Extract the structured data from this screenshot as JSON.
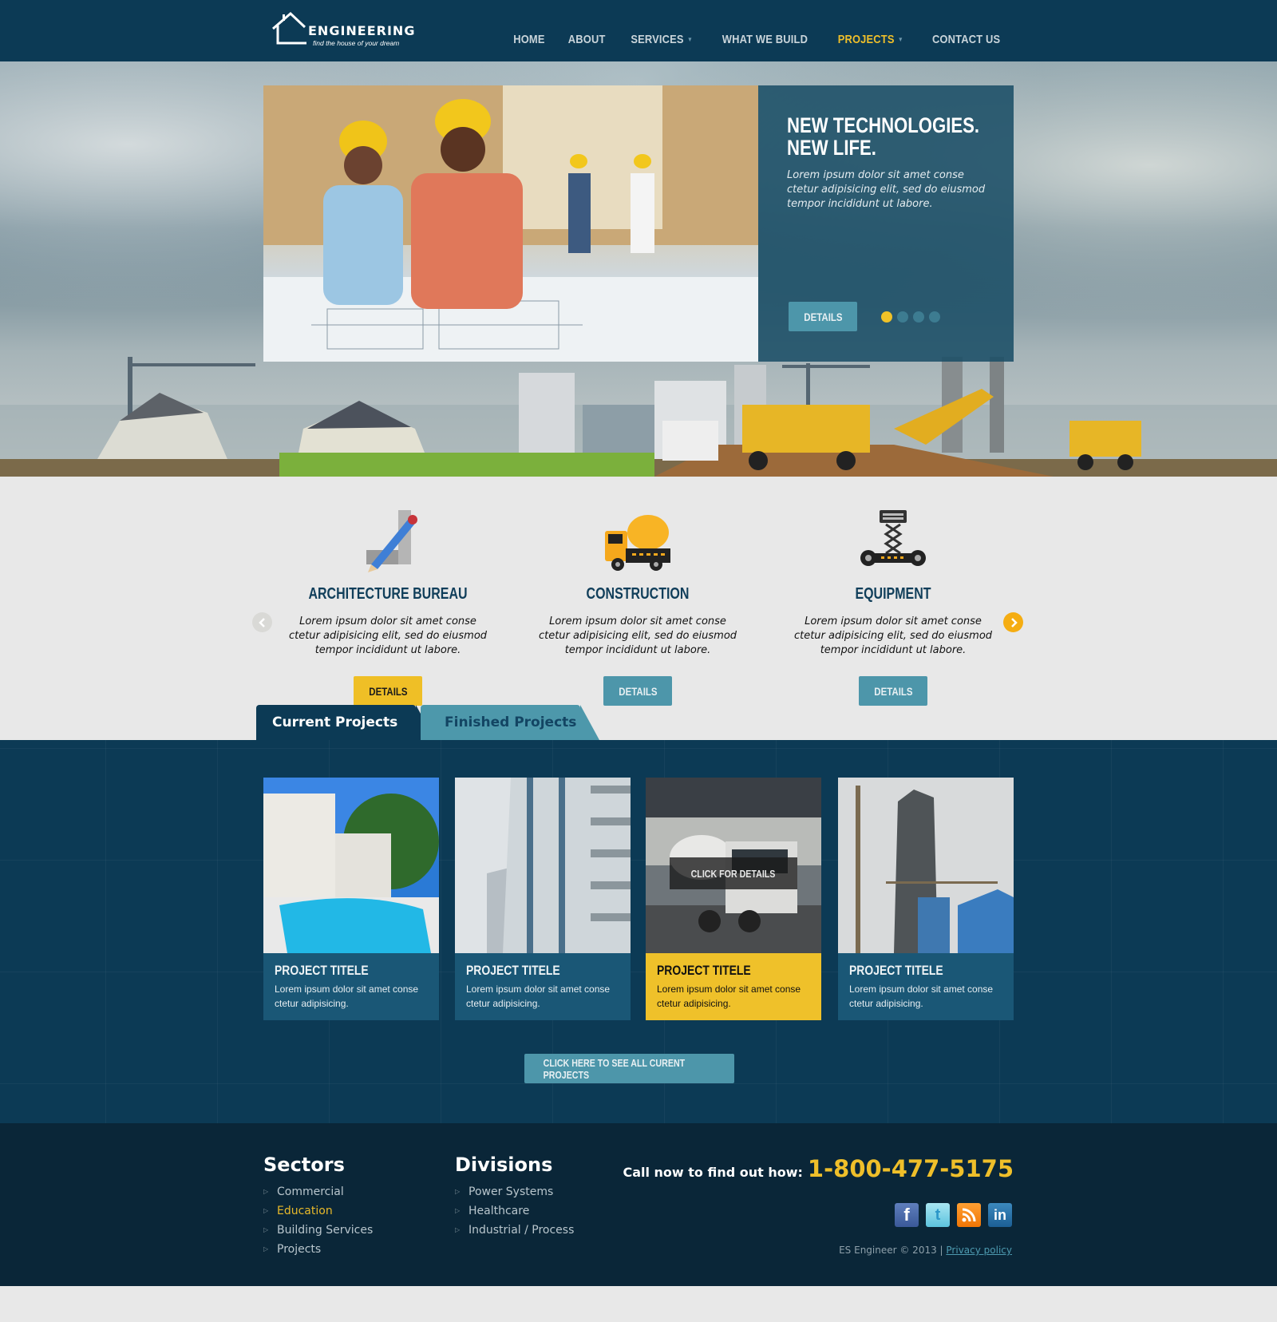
{
  "brand": {
    "name": "ENGINEERING",
    "tagline": "find the house of your dream"
  },
  "nav": {
    "items": [
      {
        "label": "HOME",
        "has_dropdown": false,
        "active": false
      },
      {
        "label": "ABOUT",
        "has_dropdown": false,
        "active": false
      },
      {
        "label": "SERVICES",
        "has_dropdown": true,
        "active": false
      },
      {
        "label": "WHAT WE BUILD",
        "has_dropdown": false,
        "active": false
      },
      {
        "label": "PROJECTS",
        "has_dropdown": true,
        "active": true
      },
      {
        "label": "CONTACT US",
        "has_dropdown": false,
        "active": false
      }
    ]
  },
  "hero": {
    "title_line1": "NEW TECHNOLOGIES.",
    "title_line2": "NEW LIFE.",
    "text": "Lorem ipsum dolor sit amet conse ctetur adipisicing elit, sed do eiusmod tempor incididunt ut labore.",
    "button": "DETAILS",
    "slide_count": 4,
    "active_slide": 1
  },
  "services": {
    "items": [
      {
        "icon": "pencil-ruler-icon",
        "title": "ARCHITECTURE BUREAU",
        "text": "Lorem ipsum dolor sit amet conse ctetur adipisicing elit, sed do eiusmod tempor incididunt ut labore.",
        "button": "DETAILS",
        "highlighted": true
      },
      {
        "icon": "concrete-mixer-truck-icon",
        "title": "CONSTRUCTION",
        "text": "Lorem ipsum dolor sit amet conse ctetur adipisicing elit, sed do eiusmod tempor incididunt ut labore.",
        "button": "DETAILS",
        "highlighted": false
      },
      {
        "icon": "scissor-lift-icon",
        "title": "EQUIPMENT",
        "text": "Lorem ipsum dolor sit amet conse ctetur adipisicing elit, sed do eiusmod tempor incididunt ut labore.",
        "button": "DETAILS",
        "highlighted": false
      }
    ]
  },
  "tabs": {
    "current": "Current Projects",
    "finished": "Finished Projects"
  },
  "projects": {
    "items": [
      {
        "title": "PROJECT TITELE",
        "text": "Lorem ipsum dolor sit amet conse ctetur adipisicing.",
        "image": "villa-pool-photo"
      },
      {
        "title": "PROJECT TITELE",
        "text": "Lorem ipsum dolor sit amet conse ctetur adipisicing.",
        "image": "highrise-facade-photo"
      },
      {
        "title": "PROJECT TITELE",
        "text": "Lorem ipsum dolor sit amet conse ctetur adipisicing.",
        "image": "concrete-truck-photo",
        "overlay": "CLICK FOR DETAILS",
        "active": true
      },
      {
        "title": "PROJECT TITELE",
        "text": "Lorem ipsum dolor sit amet conse ctetur adipisicing.",
        "image": "tower-construction-photo"
      }
    ],
    "see_all": "CLICK HERE TO SEE ALL CURENT PROJECTS"
  },
  "footer": {
    "sectors": {
      "title": "Sectors",
      "items": [
        "Commercial",
        "Education",
        "Building Services",
        "Projects"
      ],
      "highlighted": "Education"
    },
    "divisions": {
      "title": "Divisions",
      "items": [
        "Power Systems",
        "Healthcare",
        "Industrial / Process"
      ]
    },
    "call_label": "Call now to find out how:",
    "phone": "1-800-477-5175",
    "social": [
      "facebook",
      "twitter",
      "rss",
      "linkedin"
    ],
    "copyright": "ES Engineer © 2013 |",
    "privacy": "Privacy policy"
  },
  "colors": {
    "navy": "#0c3a55",
    "accent_yellow": "#efbf2a",
    "teal": "#4d96aa",
    "footer_bg": "#0a2638"
  }
}
